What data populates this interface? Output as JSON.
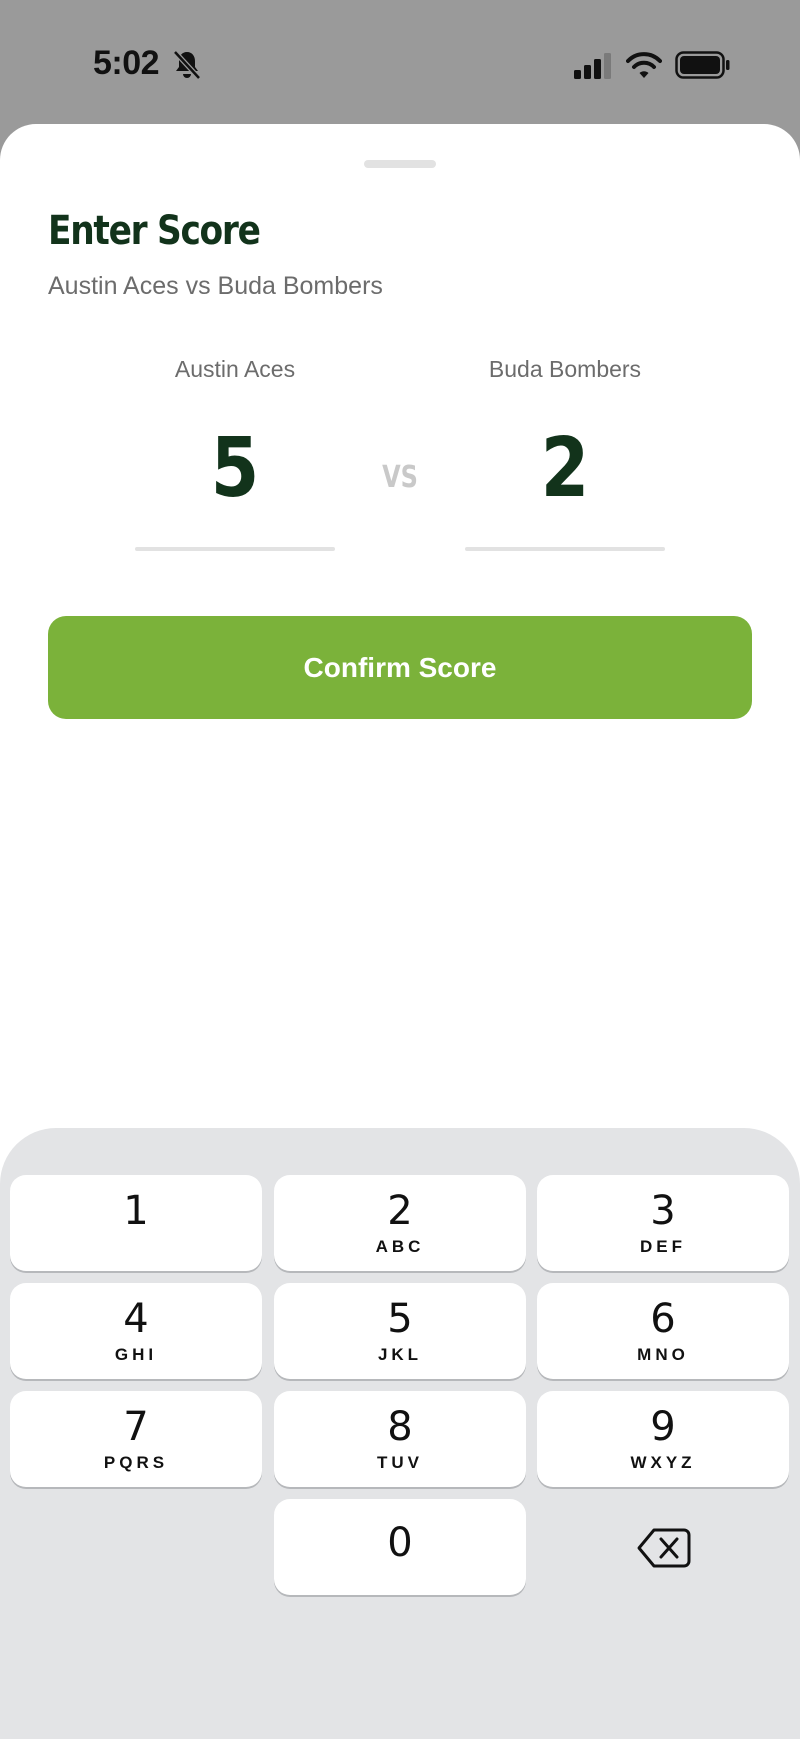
{
  "status_bar": {
    "time": "5:02",
    "icons": [
      "bell-slash-icon",
      "cellular-signal-icon",
      "wifi-icon",
      "battery-icon"
    ]
  },
  "sheet": {
    "title": "Enter Score",
    "subtitle": "Austin Aces vs Buda Bombers",
    "home_team": {
      "name": "Austin Aces",
      "score": "5"
    },
    "away_team": {
      "name": "Buda Bombers",
      "score": "2"
    },
    "vs_label": "VS",
    "confirm_label": "Confirm Score"
  },
  "keypad": {
    "keys": [
      {
        "digit": "1",
        "letters": ""
      },
      {
        "digit": "2",
        "letters": "ABC"
      },
      {
        "digit": "3",
        "letters": "DEF"
      },
      {
        "digit": "4",
        "letters": "GHI"
      },
      {
        "digit": "5",
        "letters": "JKL"
      },
      {
        "digit": "6",
        "letters": "MNO"
      },
      {
        "digit": "7",
        "letters": "PQRS"
      },
      {
        "digit": "8",
        "letters": "TUV"
      },
      {
        "digit": "9",
        "letters": "WXYZ"
      },
      {
        "digit": "0",
        "letters": ""
      }
    ],
    "backspace_icon": "delete-backspace-icon"
  },
  "colors": {
    "accent_green": "#7bb23a",
    "title_dark_green": "#12331b",
    "keypad_background": "#e3e4e6"
  }
}
